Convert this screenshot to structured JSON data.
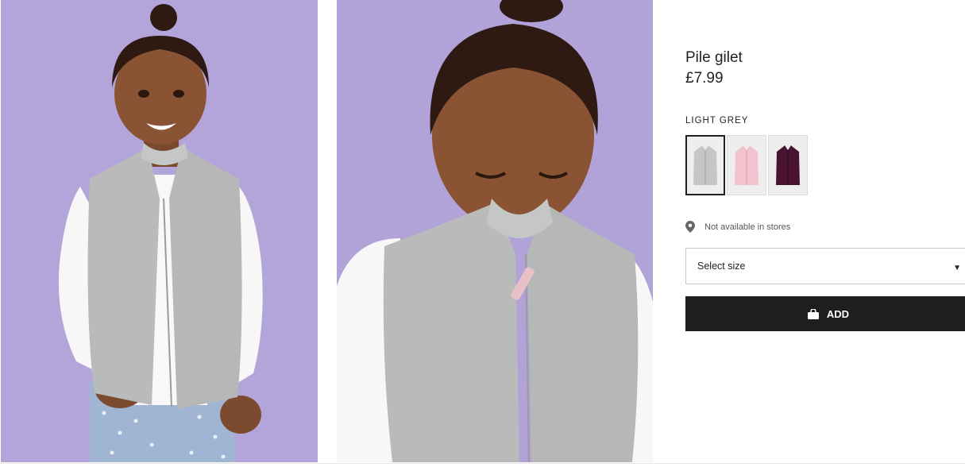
{
  "product": {
    "title": "Pile gilet",
    "price": "£7.99",
    "selected_color": "LIGHT GREY",
    "swatches": [
      {
        "color": "#c4c6c8",
        "selected": true
      },
      {
        "color": "#f2c2cf",
        "selected": false
      },
      {
        "color": "#4a1232",
        "selected": false
      }
    ],
    "availability": "Not available in stores"
  },
  "size_select": {
    "label": "Select size"
  },
  "add_button": {
    "label": "ADD"
  },
  "icons": {
    "location": "location-pin-icon",
    "bag": "shopping-bag-icon",
    "chevron": "chevron-down-icon"
  },
  "colors": {
    "background_purple": "#b5a6dc",
    "button": "#1e1e1e",
    "gilet_grey": "#b9bbbb"
  }
}
